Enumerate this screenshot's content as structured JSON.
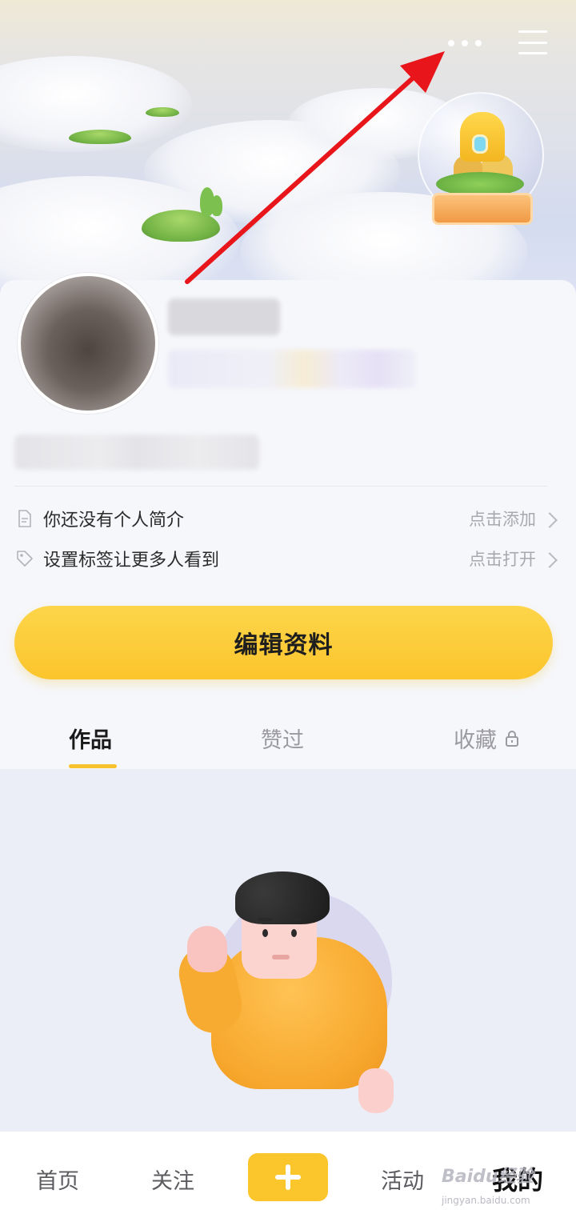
{
  "profile": {
    "bio_prompt": "你还没有个人简介",
    "bio_action": "点击添加",
    "tags_prompt": "设置标签让更多人看到",
    "tags_action": "点击打开",
    "edit_button": "编辑资料"
  },
  "tabs": [
    {
      "label": "作品",
      "active": true
    },
    {
      "label": "赞过",
      "active": false
    },
    {
      "label": "收藏",
      "active": false,
      "locked": true
    }
  ],
  "bottom_nav": {
    "items": [
      {
        "label": "首页"
      },
      {
        "label": "关注"
      },
      {
        "label": "活动"
      },
      {
        "label": "我的",
        "active": true
      }
    ],
    "add_icon": "plus-icon"
  },
  "top_bar": {
    "more_icon": "more-dots-icon",
    "menu_icon": "hamburger-menu-icon"
  },
  "annotation": {
    "arrow_color": "#e8161b"
  },
  "watermark": {
    "brand": "Baidu经验",
    "url": "jingyan.baidu.com"
  },
  "colors": {
    "accent": "#fbc52c",
    "tab_active_underline": "#f7c22b"
  }
}
